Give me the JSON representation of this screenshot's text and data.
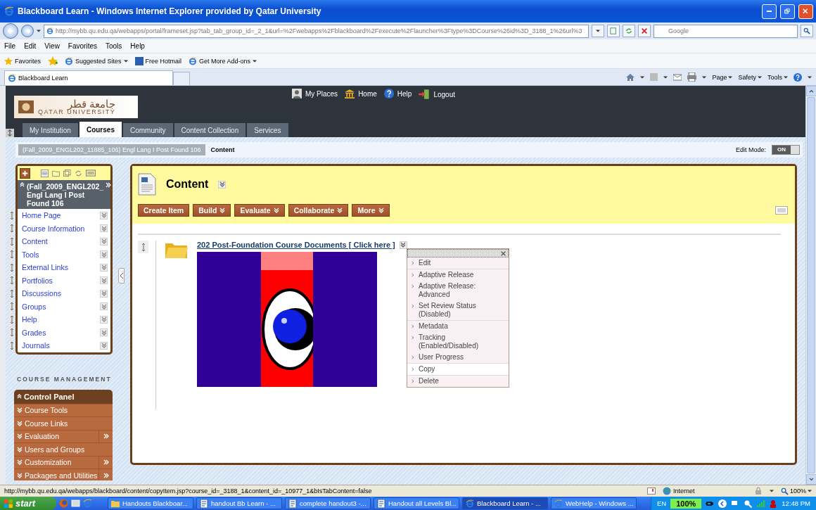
{
  "browser": {
    "title": "Blackboard Learn - Windows Internet Explorer provided by Qatar University",
    "address": "http://mybb.qu.edu.qa/webapps/portal/frameset.jsp?tab_tab_group_id=_2_1&url=%2Fwebapps%2Fblackboard%2Fexecute%2Flauncher%3Ftype%3DCourse%26id%3D_3188_1%26url%3",
    "search": {
      "placeholder": "Google"
    },
    "menu": [
      "File",
      "Edit",
      "View",
      "Favorites",
      "Tools",
      "Help"
    ],
    "favorites": {
      "label": "Favorites",
      "links": [
        {
          "label": "Suggested Sites",
          "dropdown": true
        },
        {
          "label": "Free Hotmail",
          "dropdown": false
        },
        {
          "label": "Get More Add-ons",
          "dropdown": true
        }
      ]
    },
    "tab": "Blackboard Learn",
    "commands": [
      "Page",
      "Safety",
      "Tools"
    ]
  },
  "page": {
    "top_links": [
      {
        "kind": "person",
        "label": "My Places"
      },
      {
        "kind": "home",
        "label": "Home"
      },
      {
        "kind": "help",
        "label": "Help"
      },
      {
        "kind": "logout",
        "label": "Logout"
      }
    ],
    "logo": {
      "arabic": "جامعة قطر",
      "english": "QATAR UNIVERSITY"
    },
    "tabs": [
      {
        "label": "My Institution",
        "selected": false
      },
      {
        "label": "Courses",
        "selected": true
      },
      {
        "label": "Community",
        "selected": false
      },
      {
        "label": "Content Collection",
        "selected": false
      },
      {
        "label": "Services",
        "selected": false
      }
    ],
    "breadcrumb": [
      "(Fall_2009_ENGL202_11885_106) Engl Lang I Post Found 106",
      "Content"
    ],
    "edit_mode": {
      "label": "Edit Mode:",
      "value": "ON",
      "on": true
    }
  },
  "course_menu": {
    "title": "(Fall_2009_ENGL202_ Engl Lang I Post Found 106",
    "items": [
      "Home Page",
      "Course Information",
      "Content",
      "Tools",
      "External Links",
      "Portfolios",
      "Discussions",
      "Groups",
      "Help",
      "Grades",
      "Journals"
    ]
  },
  "course_management": {
    "heading": "COURSE MANAGEMENT",
    "title": "Control Panel",
    "items": [
      {
        "label": "Course Tools",
        "submenu": false
      },
      {
        "label": "Course Links",
        "submenu": false
      },
      {
        "label": "Evaluation",
        "submenu": true
      },
      {
        "label": "Users and Groups",
        "submenu": false
      },
      {
        "label": "Customization",
        "submenu": true
      },
      {
        "label": "Packages and Utilities",
        "submenu": true
      }
    ]
  },
  "content": {
    "title": "Content",
    "buttons": [
      {
        "label": "Create Item",
        "dropdown": false
      },
      {
        "label": "Build",
        "dropdown": true
      },
      {
        "label": "Evaluate",
        "dropdown": true
      },
      {
        "label": "Collaborate",
        "dropdown": true
      },
      {
        "label": "More",
        "dropdown": true
      }
    ],
    "item": {
      "title": "202 Post-Foundation Course Documents [ Click here ]"
    },
    "context_menu": [
      [
        {
          "label": "Edit",
          "selected": false
        }
      ],
      [
        {
          "label": "Adaptive Release",
          "selected": false
        },
        {
          "label": "Adaptive Release: Advanced",
          "selected": false
        },
        {
          "label": "Set Review Status (Disabled)",
          "selected": false
        }
      ],
      [
        {
          "label": "Metadata",
          "selected": false
        },
        {
          "label": "Tracking (Enabled/Disabled)",
          "selected": false
        },
        {
          "label": "User Progress",
          "selected": false
        }
      ],
      [
        {
          "label": "Copy",
          "selected": true
        }
      ],
      [
        {
          "label": "Delete",
          "selected": false
        }
      ]
    ]
  },
  "status_bar": {
    "url": "http://mybb.qu.edu.qa/webapps/blackboard/content/copyItem.jsp?course_id=_3188_1&content_id=_10977_1&bIsTabContent=false",
    "zone": "Internet",
    "zoom": "100%"
  },
  "taskbar": {
    "start": "start",
    "tasks": [
      {
        "label": "Handouts Blackboar...",
        "kind": "folder",
        "selected": false
      },
      {
        "label": "handout Bb Learn - ...",
        "kind": "word",
        "selected": false
      },
      {
        "label": "complete handout3 -...",
        "kind": "word",
        "selected": false
      },
      {
        "label": "Handout all Levels Bl...",
        "kind": "word",
        "selected": false
      },
      {
        "label": "Blackboard Learn - ...",
        "kind": "ie",
        "selected": true
      },
      {
        "label": "WebHelp - Windows ...",
        "kind": "ie",
        "selected": false
      }
    ],
    "language": "EN",
    "battery": "100%",
    "clock": "12:48 PM"
  }
}
